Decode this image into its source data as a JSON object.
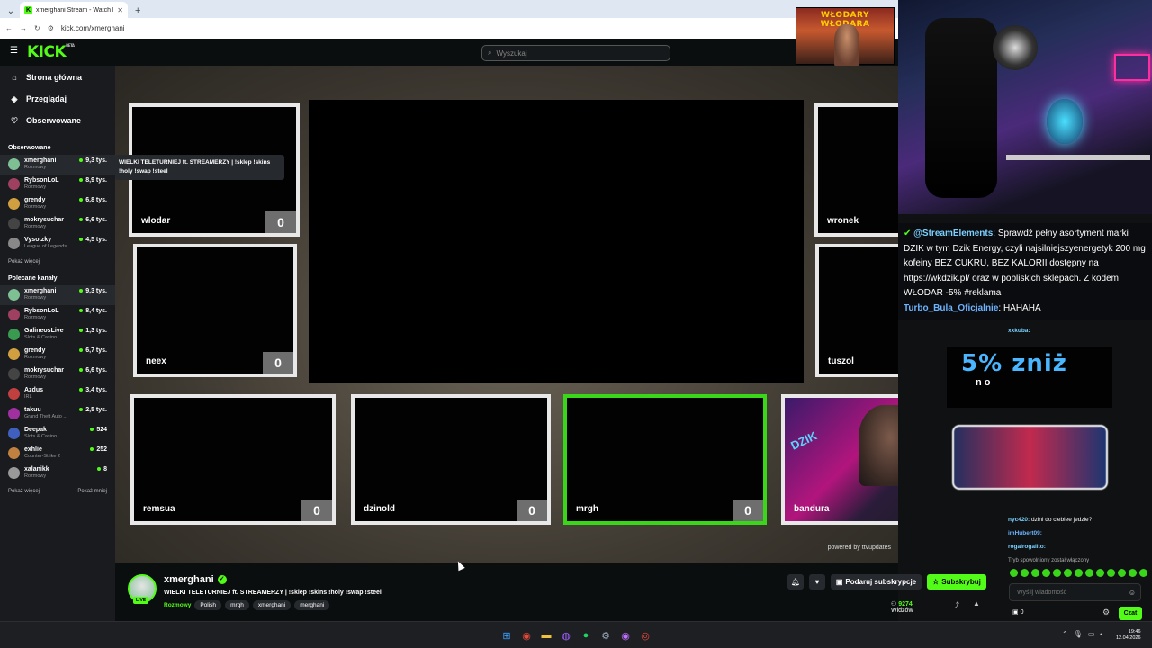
{
  "browser": {
    "tab_title": "xmerghani Stream - Watch Live",
    "url": "kick.com/xmerghani",
    "new_tab": "+"
  },
  "header": {
    "logo": "KICK",
    "logo_badge": "BETA",
    "search_placeholder": "Wyszukaj"
  },
  "sidebar": {
    "nav": [
      {
        "label": "Strona główna",
        "icon": "home-icon"
      },
      {
        "label": "Przeglądaj",
        "icon": "compass-icon"
      },
      {
        "label": "Obserwowane",
        "icon": "heart-icon"
      }
    ],
    "followed_title": "Obserwowane",
    "followed": [
      {
        "name": "xmerghani",
        "category": "Rozmowy",
        "viewers": "9,3 tys.",
        "color": "#7fbf94"
      },
      {
        "name": "RybsonLoL",
        "category": "Rozmowy",
        "viewers": "8,9 tys.",
        "color": "#a04060"
      },
      {
        "name": "grendy",
        "category": "Rozmowy",
        "viewers": "6,8 tys.",
        "color": "#d0a040"
      },
      {
        "name": "mokrysuchar",
        "category": "Rozmowy",
        "viewers": "6,6 tys.",
        "color": "#444"
      },
      {
        "name": "Vysotzky",
        "category": "League of Legends",
        "viewers": "4,5 tys.",
        "color": "#888"
      }
    ],
    "followed_more": "Pokaż więcej",
    "recommended_title": "Polecane kanały",
    "recommended": [
      {
        "name": "xmerghani",
        "category": "Rozmowy",
        "viewers": "9,3 tys.",
        "color": "#7fbf94"
      },
      {
        "name": "RybsonLoL",
        "category": "Rozmowy",
        "viewers": "8,4 tys.",
        "color": "#a04060"
      },
      {
        "name": "GalineosLive",
        "category": "Slots & Casino",
        "viewers": "1,3 tys.",
        "color": "#3a9a50"
      },
      {
        "name": "grendy",
        "category": "Rozmowy",
        "viewers": "6,7 tys.",
        "color": "#d0a040"
      },
      {
        "name": "mokrysuchar",
        "category": "Rozmowy",
        "viewers": "6,6 tys.",
        "color": "#444"
      },
      {
        "name": "Azdus",
        "category": "IRL",
        "viewers": "3,4 tys.",
        "color": "#c04040"
      },
      {
        "name": "takuu",
        "category": "Grand Theft Auto ...",
        "viewers": "2,5 tys.",
        "color": "#a030a0"
      },
      {
        "name": "Deepak",
        "category": "Slots & Casino",
        "viewers": "524",
        "color": "#4060c0"
      },
      {
        "name": "exhlie",
        "category": "Counter-Strike 2",
        "viewers": "252",
        "color": "#c08040"
      },
      {
        "name": "xalanikk",
        "category": "Rozmowy",
        "viewers": "8",
        "color": "#999"
      }
    ],
    "show_more": "Pokaż więcej",
    "show_less": "Pokaż mniej",
    "tooltip": "WIELKI TELETURNIEJ ft. STREAMERZY | !sklep !skins !holy !swap !steel"
  },
  "overlay": {
    "banner": "WŁODARY\nWŁODARA",
    "players": [
      {
        "name": "wlodar",
        "score": "0"
      },
      {
        "name": "neex",
        "score": "0"
      },
      {
        "name": "wronek",
        "score": "0"
      },
      {
        "name": "tuszol",
        "score": "0"
      },
      {
        "name": "remsua",
        "score": "0"
      },
      {
        "name": "dzinold",
        "score": "0"
      },
      {
        "name": "mrgh",
        "score": "0"
      },
      {
        "name": "bandura",
        "score": "0"
      }
    ],
    "powered": "powered by ttvupdates",
    "promo_pct": "5% zniż",
    "promo_code": "n o",
    "cam_brand": "DZIK"
  },
  "chat": {
    "sys_user": "@StreamElements",
    "sys_text": ": Sprawdź pełny asortyment marki DZIK w tym Dzik Energy, czyli najsilniejszyenergetyk 200 mg kofeiny BEZ CUKRU, BEZ KALORII dostępny na https://wkdzik.pl/ oraz w pobliskich sklepach. Z kodem WŁODAR -5% #reklama",
    "user2": "Turbo_Bula_Oficjalnie",
    "user2_text": ": HAHAHA",
    "lines": [
      {
        "user": "xxkuba:",
        "text": "",
        "color": "#7ad1ff"
      },
      {
        "user": "nyc420:",
        "text": "dzini do ciebiee jedzie?",
        "color": "#7ad1ff"
      },
      {
        "user": "imHubert09:",
        "text": "",
        "color": "#6cb4ff"
      },
      {
        "user": "rogalrogalito:",
        "text": "",
        "color": "#7ad1ff"
      }
    ],
    "status": "Tryb spowolniony został włączony",
    "input_placeholder": "Wyślij wiadomość",
    "points": "0",
    "send": "Czat"
  },
  "stream": {
    "name": "xmerghani",
    "live": "LIVE",
    "title": "WIELKI TELETURNIEJ ft. STREAMERZY | !sklep !skins !holy !swap !steel",
    "category": "Rozmowy",
    "tags": [
      "Polish",
      "mrgh",
      "xmerghani",
      "merghani"
    ],
    "gift": "Podaruj subskrypcje",
    "subscribe": "Subskrybuj",
    "viewers": "9274",
    "viewers_label": "Widzów"
  },
  "taskbar": {
    "time": "19:46",
    "date": "12.04.2026"
  }
}
